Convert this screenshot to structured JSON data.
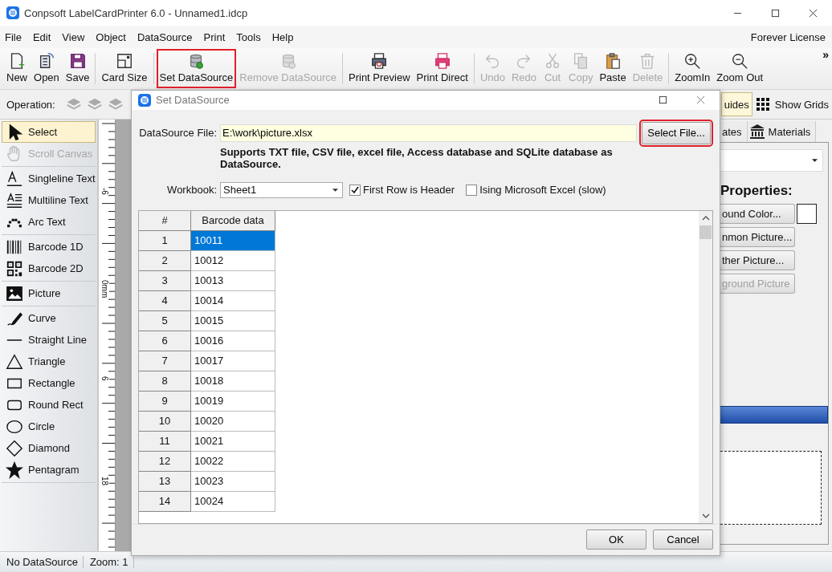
{
  "window": {
    "title": "Conpsoft LabelCardPrinter 6.0 - Unnamed1.idcp"
  },
  "menu": [
    "File",
    "Edit",
    "View",
    "Object",
    "DataSource",
    "Print",
    "Tools",
    "Help"
  ],
  "license": "Forever License",
  "toolbar": [
    [
      {
        "label": "New",
        "kind": "new",
        "disabled": false,
        "highlighted": false
      },
      {
        "label": "Open",
        "kind": "open",
        "disabled": false,
        "highlighted": false
      },
      {
        "label": "Save",
        "kind": "save",
        "disabled": false,
        "highlighted": false
      }
    ],
    [
      {
        "label": "Card Size",
        "kind": "card",
        "disabled": false,
        "highlighted": false
      }
    ],
    [
      {
        "label": "Set DataSource",
        "kind": "database",
        "disabled": false,
        "highlighted": true
      },
      {
        "label": "Remove DataSource",
        "kind": "database",
        "disabled": true,
        "highlighted": false
      }
    ],
    [
      {
        "label": "Print Preview",
        "kind": "preview",
        "disabled": false,
        "highlighted": false
      },
      {
        "label": "Print Direct",
        "kind": "printer",
        "disabled": false,
        "highlighted": false
      }
    ],
    [
      {
        "label": "Undo",
        "kind": "undo",
        "disabled": true,
        "highlighted": false
      },
      {
        "label": "Redo",
        "kind": "redo",
        "disabled": true,
        "highlighted": false
      },
      {
        "label": "Cut",
        "kind": "cut",
        "disabled": true,
        "highlighted": false
      },
      {
        "label": "Copy",
        "kind": "copy",
        "disabled": true,
        "highlighted": false
      },
      {
        "label": "Paste",
        "kind": "paste",
        "disabled": false,
        "highlighted": false
      },
      {
        "label": "Delete",
        "kind": "delete",
        "disabled": true,
        "highlighted": false
      }
    ],
    [
      {
        "label": "ZoomIn",
        "kind": "zoomin",
        "disabled": false,
        "highlighted": false
      },
      {
        "label": "Zoom Out",
        "kind": "zoomout",
        "disabled": false,
        "highlighted": false
      }
    ]
  ],
  "toolbar_more": "»",
  "operation": {
    "label": "Operation:",
    "guides": {
      "label": "uides",
      "on": true
    },
    "grids": {
      "label": "Show Grids",
      "on": false
    }
  },
  "tools": [
    [
      {
        "label": "Select",
        "kind": "select",
        "selected": true,
        "disabled": false
      },
      {
        "label": "Scroll Canvas",
        "kind": "hand",
        "selected": false,
        "disabled": true
      }
    ],
    [
      {
        "label": "Singleline Text",
        "kind": "text",
        "selected": false,
        "disabled": false
      },
      {
        "label": "Multiline Text",
        "kind": "multiline",
        "selected": false,
        "disabled": false
      },
      {
        "label": "Arc Text",
        "kind": "arc",
        "selected": false,
        "disabled": false
      }
    ],
    [
      {
        "label": "Barcode 1D",
        "kind": "barcode",
        "selected": false,
        "disabled": false
      },
      {
        "label": "Barcode 2D",
        "kind": "qr",
        "selected": false,
        "disabled": false
      }
    ],
    [
      {
        "label": "Picture",
        "kind": "picture",
        "selected": false,
        "disabled": false
      }
    ],
    [
      {
        "label": "Curve",
        "kind": "curve",
        "selected": false,
        "disabled": false
      },
      {
        "label": "Straight Line",
        "kind": "line",
        "selected": false,
        "disabled": false
      },
      {
        "label": "Triangle",
        "kind": "triangle",
        "selected": false,
        "disabled": false
      },
      {
        "label": "Rectangle",
        "kind": "rect",
        "selected": false,
        "disabled": false
      },
      {
        "label": "Round Rect",
        "kind": "roundrect",
        "selected": false,
        "disabled": false
      },
      {
        "label": "Circle",
        "kind": "circle",
        "selected": false,
        "disabled": false
      },
      {
        "label": "Diamond",
        "kind": "diamond",
        "selected": false,
        "disabled": false
      },
      {
        "label": "Pentagram",
        "kind": "star",
        "selected": false,
        "disabled": false
      }
    ]
  ],
  "ruler": [
    "-6",
    "0mm",
    "6",
    "18"
  ],
  "right_panel": {
    "tabs": [
      {
        "label": "ates",
        "selected": false
      },
      {
        "label": "Materials",
        "selected": false
      }
    ],
    "heading": "Properties:",
    "buttons": [
      {
        "label": "ound Color...",
        "disabled": false
      },
      {
        "label": "nmon Picture...",
        "disabled": false
      },
      {
        "label": "ther Picture...",
        "disabled": false
      },
      {
        "label": "ground Picture",
        "disabled": true
      }
    ]
  },
  "status_bar": [
    "No DataSource",
    "Zoom: 1"
  ],
  "dialog": {
    "title": "Set DataSource",
    "file_label": "DataSource File:",
    "file_value": "E:\\work\\picture.xlsx",
    "select_button": {
      "label": "Select File...",
      "highlighted": true
    },
    "note": "Supports TXT file, CSV file, excel file, Access database and SQLite database as DataSource.",
    "workbook_label": "Workbook:",
    "workbook": "Sheet1",
    "options": [
      {
        "label": "First Row is Header",
        "checked": true
      },
      {
        "label": "Ising Microsoft Excel (slow)",
        "checked": false
      }
    ],
    "table": {
      "columns": [
        "#",
        "Barcode data"
      ],
      "rows": [
        {
          "n": "1",
          "value": "10011",
          "selected": true
        },
        {
          "n": "2",
          "value": "10012",
          "selected": false
        },
        {
          "n": "3",
          "value": "10013",
          "selected": false
        },
        {
          "n": "4",
          "value": "10014",
          "selected": false
        },
        {
          "n": "5",
          "value": "10015",
          "selected": false
        },
        {
          "n": "6",
          "value": "10016",
          "selected": false
        },
        {
          "n": "7",
          "value": "10017",
          "selected": false
        },
        {
          "n": "8",
          "value": "10018",
          "selected": false
        },
        {
          "n": "9",
          "value": "10019",
          "selected": false
        },
        {
          "n": "10",
          "value": "10020",
          "selected": false
        },
        {
          "n": "11",
          "value": "10021",
          "selected": false
        },
        {
          "n": "12",
          "value": "10022",
          "selected": false
        },
        {
          "n": "13",
          "value": "10023",
          "selected": false
        },
        {
          "n": "14",
          "value": "10024",
          "selected": false
        }
      ]
    },
    "buttons": [
      "OK",
      "Cancel"
    ]
  }
}
